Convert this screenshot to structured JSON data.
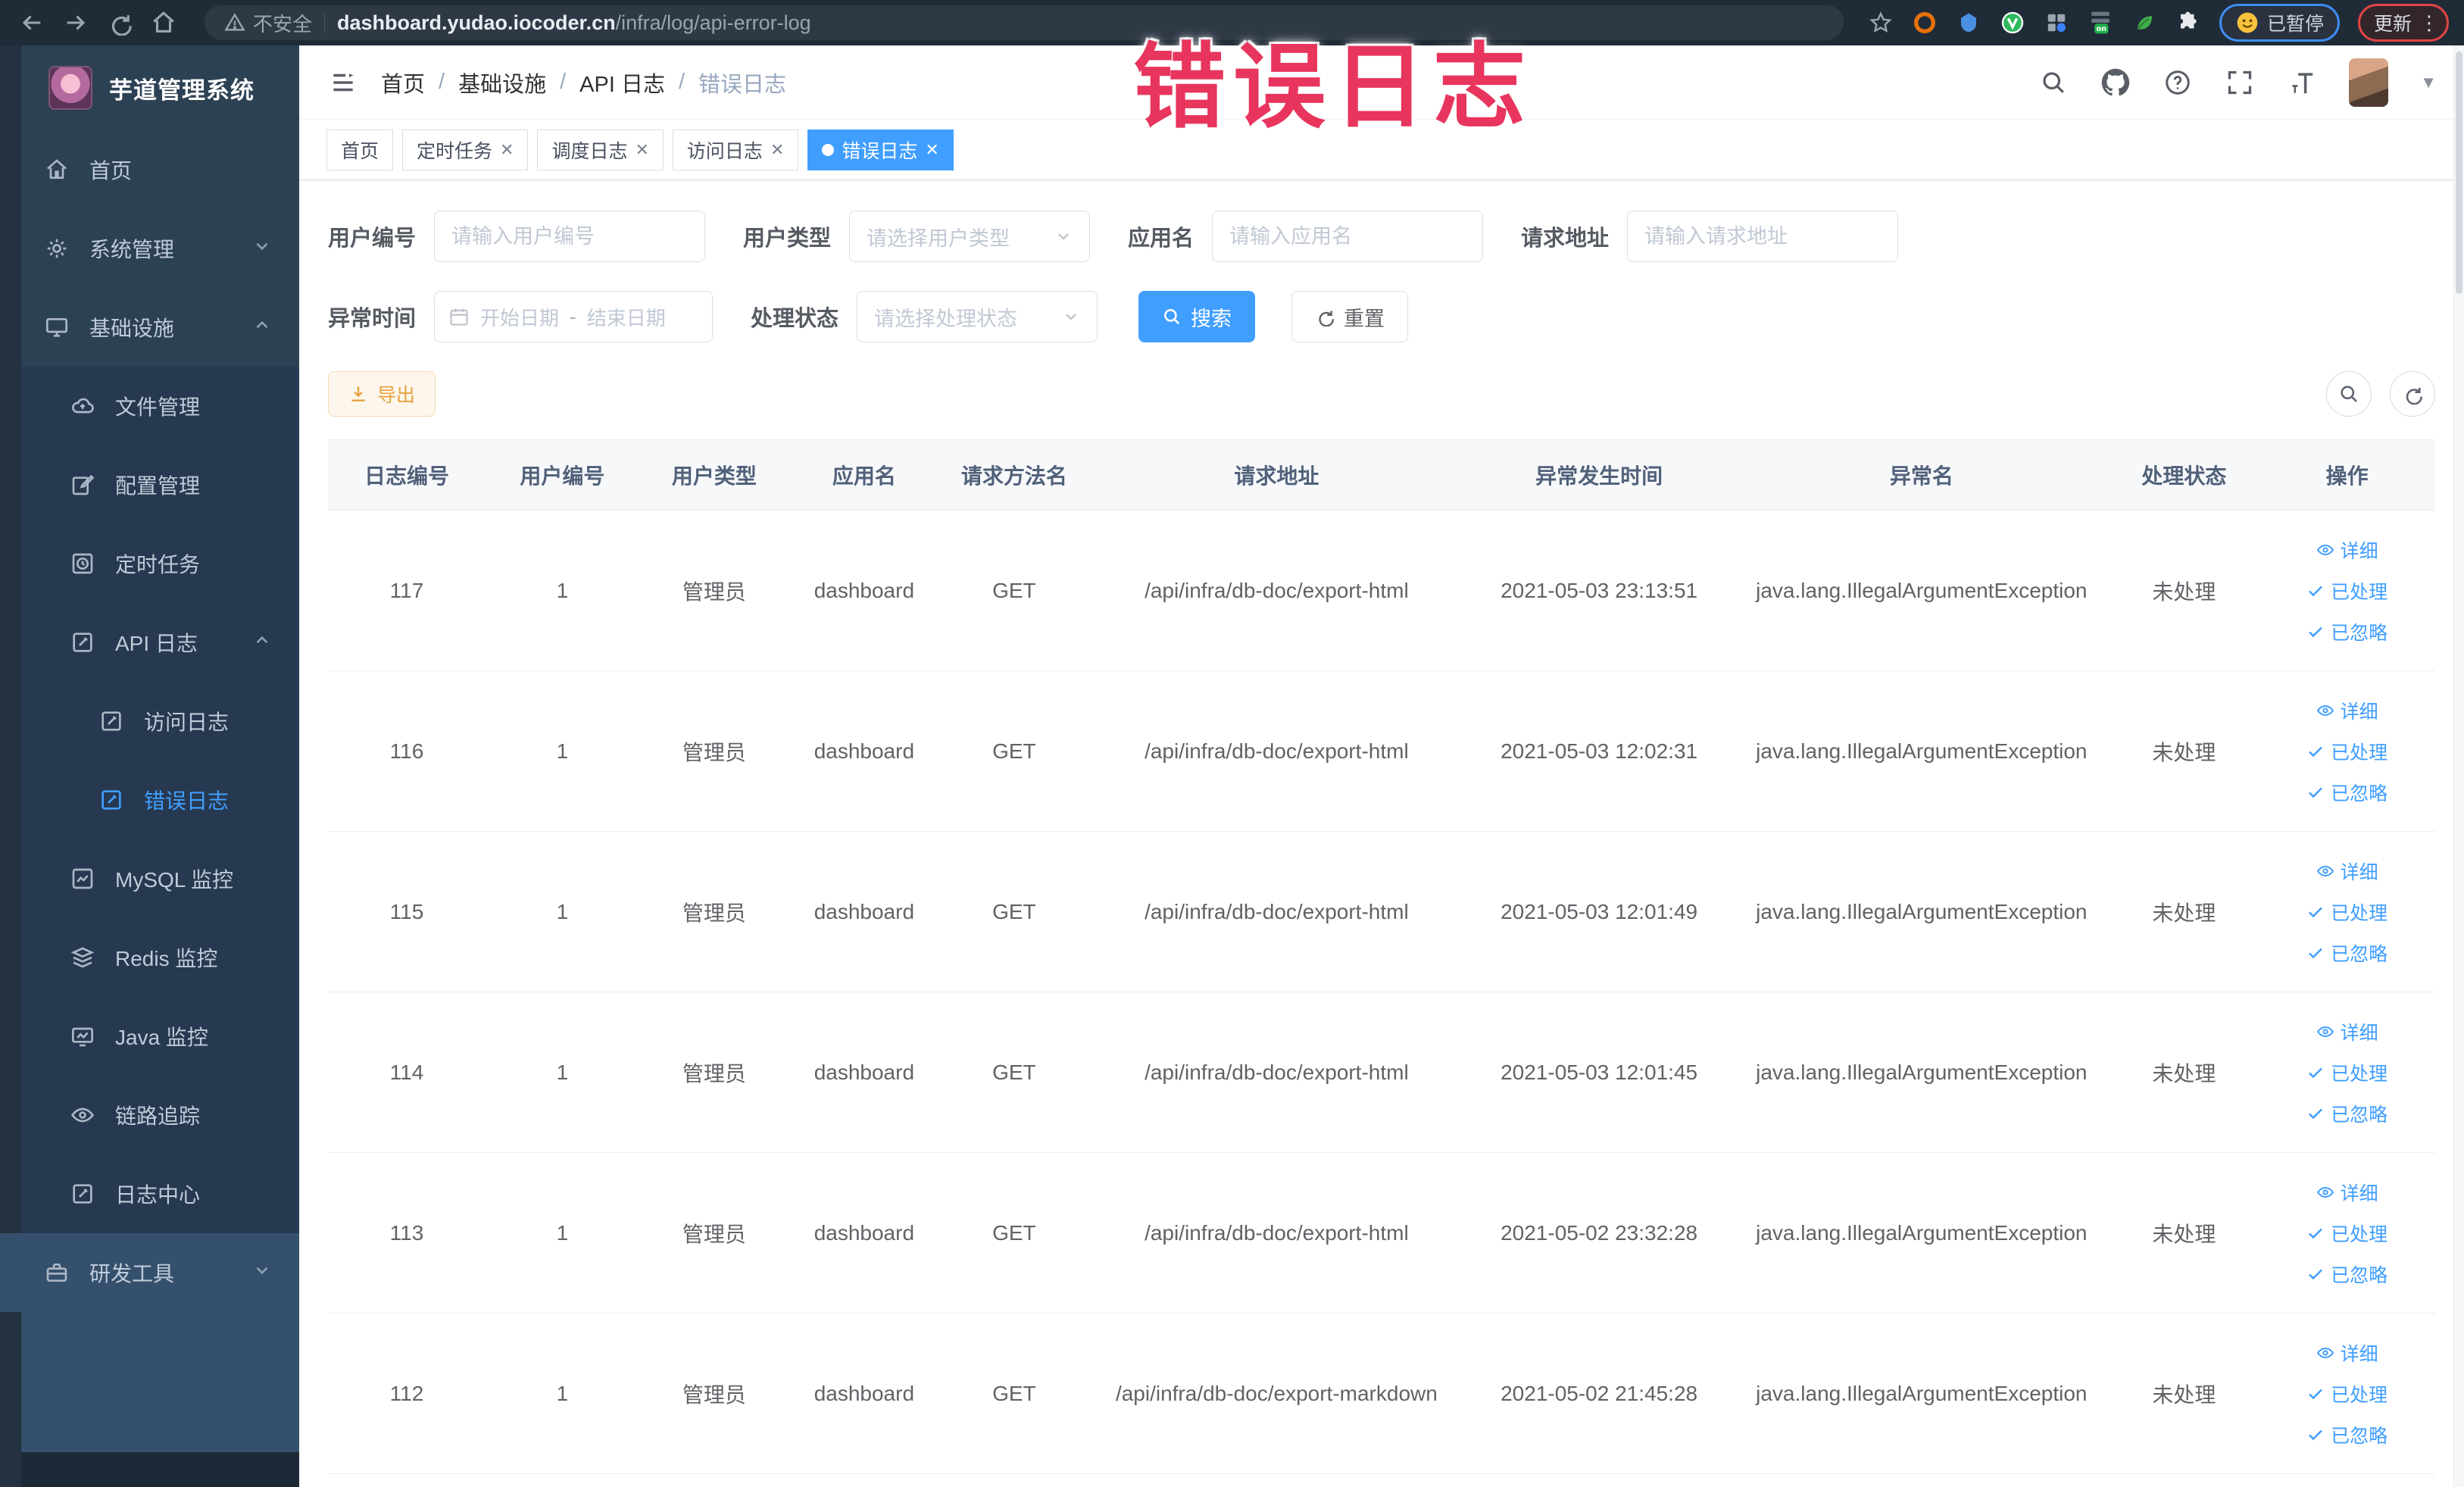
{
  "browser": {
    "security_label": "不安全",
    "url_domain": "dashboard.yudao.iocoder.cn",
    "url_path": "/infra/log/api-error-log",
    "paused_badge": "已暂停",
    "update_badge": "更新"
  },
  "annotation": {
    "text": "错误日志",
    "color": "#e8355d"
  },
  "sidebar": {
    "logo_title": "芋道管理系统",
    "items": [
      {
        "label": "首页",
        "icon": "home-icon"
      },
      {
        "label": "系统管理",
        "icon": "gear-icon"
      },
      {
        "label": "基础设施",
        "icon": "monitor-icon"
      },
      {
        "label": "文件管理",
        "icon": "cloud-icon"
      },
      {
        "label": "配置管理",
        "icon": "edit-icon"
      },
      {
        "label": "定时任务",
        "icon": "clock-icon"
      },
      {
        "label": "API 日志",
        "icon": "doc-icon"
      },
      {
        "label": "访问日志",
        "icon": "doc-icon"
      },
      {
        "label": "错误日志",
        "icon": "doc-icon"
      },
      {
        "label": "MySQL 监控",
        "icon": "chart-icon"
      },
      {
        "label": "Redis 监控",
        "icon": "stack-icon"
      },
      {
        "label": "Java 监控",
        "icon": "screen-icon"
      },
      {
        "label": "链路追踪",
        "icon": "eye-icon"
      },
      {
        "label": "日志中心",
        "icon": "doc-icon"
      },
      {
        "label": "研发工具",
        "icon": "toolbox-icon"
      }
    ]
  },
  "breadcrumb": {
    "separator": "/",
    "items": [
      "首页",
      "基础设施",
      "API 日志",
      "错误日志"
    ]
  },
  "tabs": [
    {
      "label": "首页"
    },
    {
      "label": "定时任务"
    },
    {
      "label": "调度日志"
    },
    {
      "label": "访问日志"
    },
    {
      "label": "错误日志"
    }
  ],
  "filters": {
    "user_id": {
      "label": "用户编号",
      "placeholder": "请输入用户编号"
    },
    "user_type": {
      "label": "用户类型",
      "placeholder": "请选择用户类型"
    },
    "app_name": {
      "label": "应用名",
      "placeholder": "请输入应用名"
    },
    "request_url": {
      "label": "请求地址",
      "placeholder": "请输入请求地址"
    },
    "exception_time": {
      "label": "异常时间",
      "start_placeholder": "开始日期",
      "separator": "-",
      "end_placeholder": "结束日期"
    },
    "process_status": {
      "label": "处理状态",
      "placeholder": "请选择处理状态"
    },
    "search_label": "搜索",
    "reset_label": "重置"
  },
  "toolbar": {
    "export_label": "导出"
  },
  "table": {
    "columns": [
      "日志编号",
      "用户编号",
      "用户类型",
      "应用名",
      "请求方法名",
      "请求地址",
      "异常发生时间",
      "异常名",
      "处理状态",
      "操作"
    ],
    "actions": {
      "detail": "详细",
      "processed": "已处理",
      "ignore": "已忽略"
    },
    "rows": [
      {
        "id": "117",
        "user_id": "1",
        "user_type": "管理员",
        "app": "dashboard",
        "method": "GET",
        "url": "/api/infra/db-doc/export-html",
        "time": "2021-05-03 23:13:51",
        "exception": "java.lang.IllegalArgumentException",
        "status": "未处理"
      },
      {
        "id": "116",
        "user_id": "1",
        "user_type": "管理员",
        "app": "dashboard",
        "method": "GET",
        "url": "/api/infra/db-doc/export-html",
        "time": "2021-05-03 12:02:31",
        "exception": "java.lang.IllegalArgumentException",
        "status": "未处理"
      },
      {
        "id": "115",
        "user_id": "1",
        "user_type": "管理员",
        "app": "dashboard",
        "method": "GET",
        "url": "/api/infra/db-doc/export-html",
        "time": "2021-05-03 12:01:49",
        "exception": "java.lang.IllegalArgumentException",
        "status": "未处理"
      },
      {
        "id": "114",
        "user_id": "1",
        "user_type": "管理员",
        "app": "dashboard",
        "method": "GET",
        "url": "/api/infra/db-doc/export-html",
        "time": "2021-05-03 12:01:45",
        "exception": "java.lang.IllegalArgumentException",
        "status": "未处理"
      },
      {
        "id": "113",
        "user_id": "1",
        "user_type": "管理员",
        "app": "dashboard",
        "method": "GET",
        "url": "/api/infra/db-doc/export-html",
        "time": "2021-05-02 23:32:28",
        "exception": "java.lang.IllegalArgumentException",
        "status": "未处理"
      },
      {
        "id": "112",
        "user_id": "1",
        "user_type": "管理员",
        "app": "dashboard",
        "method": "GET",
        "url": "/api/infra/db-doc/export-markdown",
        "time": "2021-05-02 21:45:28",
        "exception": "java.lang.IllegalArgumentException",
        "status": "未处理"
      }
    ]
  },
  "colors": {
    "accent": "#409eff",
    "warning": "#e6a23c",
    "annotation_red": "#e8355d",
    "sidebar_bg": "#2d4154"
  }
}
